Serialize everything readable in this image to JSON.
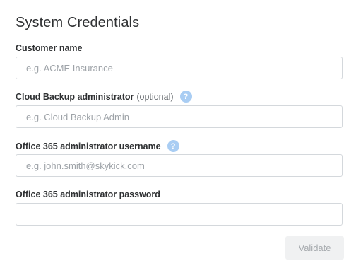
{
  "form": {
    "title": "System Credentials",
    "customer_name": {
      "label": "Customer name",
      "placeholder": "e.g. ACME Insurance",
      "value": ""
    },
    "cloud_backup_admin": {
      "label": "Cloud Backup administrator",
      "optional": "(optional)",
      "placeholder": "e.g. Cloud Backup Admin",
      "value": "",
      "help_icon": "question-mark-icon"
    },
    "o365_username": {
      "label": "Office 365 administrator username",
      "placeholder": "e.g. john.smith@skykick.com",
      "value": "",
      "help_icon": "question-mark-icon"
    },
    "o365_password": {
      "label": "Office 365 administrator password",
      "placeholder": "",
      "value": ""
    },
    "validate_label": "Validate",
    "validate_enabled": false
  },
  "colors": {
    "help_icon": "#a9cdf3",
    "input_border": "#d4d8dc",
    "button_disabled_bg": "#f0f1f2",
    "button_disabled_text": "#a6aaae"
  }
}
